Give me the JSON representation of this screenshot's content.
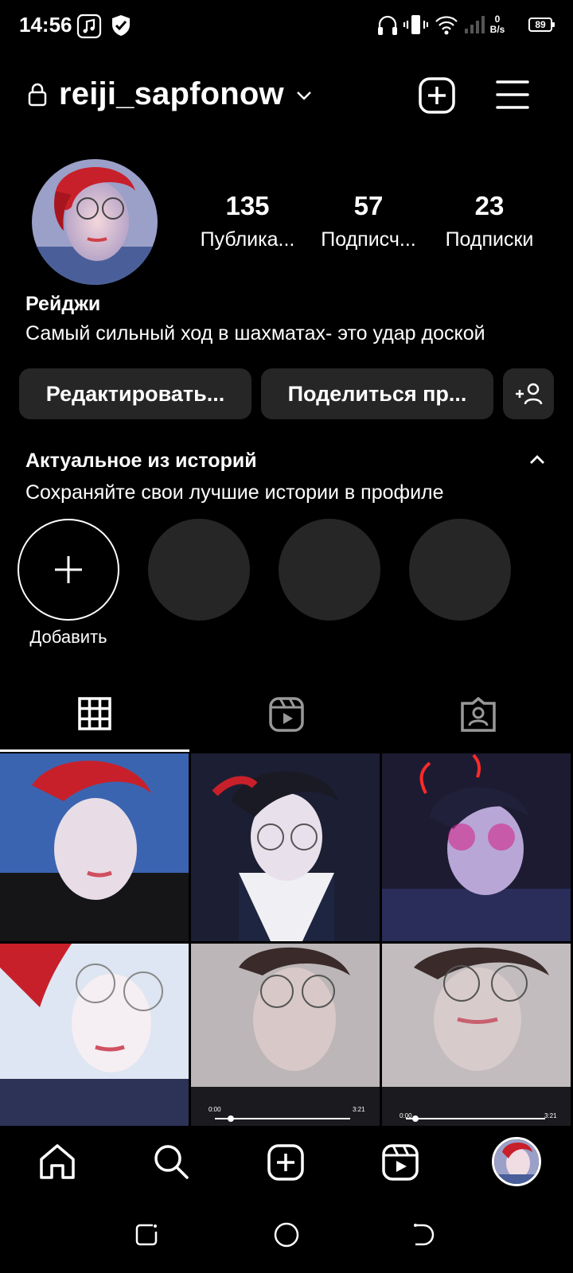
{
  "status_bar": {
    "time": "14:56",
    "net_speed_value": "0",
    "net_speed_unit": "B/s",
    "battery": "89"
  },
  "header": {
    "username": "reiji_sapfonow"
  },
  "profile": {
    "stats": [
      {
        "value": "135",
        "label": "Публика..."
      },
      {
        "value": "57",
        "label": "Подписч..."
      },
      {
        "value": "23",
        "label": "Подписки"
      }
    ],
    "name": "Рейджи",
    "bio": "Самый сильный ход в шахматах- это удар доской"
  },
  "actions": {
    "edit_label": "Редактировать...",
    "share_label": "Поделиться пр..."
  },
  "highlights": {
    "title": "Актуальное из историй",
    "subtitle": "Сохраняйте свои лучшие истории в профиле",
    "add_label": "Добавить"
  },
  "grid": {
    "video_start": "0:00",
    "video_end": "3:21"
  },
  "colors": {
    "background": "#000000",
    "button_bg": "#262626",
    "accent_red": "#c8202a"
  }
}
